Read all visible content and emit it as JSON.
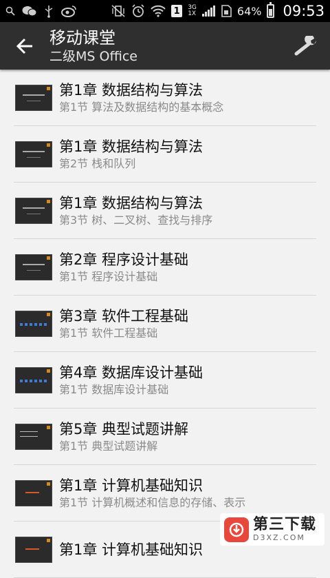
{
  "status_bar": {
    "battery_percent": "64%",
    "time": "09:53",
    "net_top": "3G",
    "net_bottom": "1X",
    "sim_badge": "1",
    "icons": [
      "search-icon",
      "wechat-icon",
      "usb-icon",
      "weibo-icon",
      "mute-vibrate-icon",
      "alarm-icon",
      "wifi-icon",
      "sim-icon",
      "signal-icon",
      "battery-icon"
    ]
  },
  "action_bar": {
    "title": "移动课堂",
    "subtitle": "二级MS Office",
    "back_icon": "back-arrow-icon",
    "settings_icon": "wrench-icon"
  },
  "items": [
    {
      "title": "第1章 数据结构与算法",
      "sub": "第1节 算法及数据结构的基本概念"
    },
    {
      "title": "第1章 数据结构与算法",
      "sub": "第2节 栈和队列"
    },
    {
      "title": "第1章 数据结构与算法",
      "sub": "第3节 树、二叉树、查找与排序"
    },
    {
      "title": "第2章 程序设计基础",
      "sub": "第1节 程序设计基础"
    },
    {
      "title": "第3章 软件工程基础",
      "sub": "第1节 软件工程基础"
    },
    {
      "title": "第4章 数据库设计基础",
      "sub": "第1节 数据库设计基础"
    },
    {
      "title": "第5章 典型试题讲解",
      "sub": "第1节 典型试题讲解"
    },
    {
      "title": "第1章 计算机基础知识",
      "sub": "第1节 计算机概述和信息的存储、表示"
    },
    {
      "title": "第1章 计算机基础知识",
      "sub": ""
    }
  ],
  "watermark": {
    "name": "第三下载",
    "domain": "D3XZ.COM"
  }
}
